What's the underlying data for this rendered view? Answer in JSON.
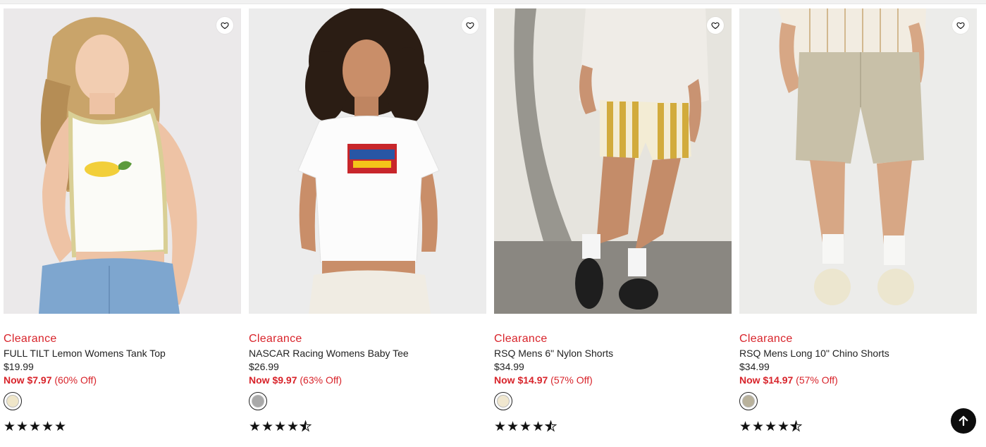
{
  "products": [
    {
      "badge": "Clearance",
      "name": "FULL TILT Lemon Womens Tank Top",
      "price": "$19.99",
      "sale_price": "Now $7.97",
      "discount": "(60% Off)",
      "swatch_color": "#efe6c9",
      "rating": 5,
      "image": "woman-lemon-tank-top"
    },
    {
      "badge": "Clearance",
      "name": "NASCAR Racing Womens Baby Tee",
      "price": "$26.99",
      "sale_price": "Now $9.97",
      "discount": "(63% Off)",
      "swatch_color": "#a9a9a9",
      "rating": 4.5,
      "image": "woman-nascar-baby-tee"
    },
    {
      "badge": "Clearance",
      "name": "RSQ Mens 6\" Nylon Shorts",
      "price": "$34.99",
      "sale_price": "Now $14.97",
      "discount": "(57% Off)",
      "swatch_color": "#f0e7cf",
      "rating": 4.5,
      "image": "man-striped-nylon-shorts"
    },
    {
      "badge": "Clearance",
      "name": "RSQ Mens Long 10\" Chino Shorts",
      "price": "$34.99",
      "sale_price": "Now $14.97",
      "discount": "(57% Off)",
      "swatch_color": "#b9b29c",
      "rating": 4.5,
      "image": "man-khaki-chino-shorts"
    }
  ],
  "icons": {
    "favorite": "heart-icon",
    "back_to_top": "arrow-up-icon",
    "rating": "star-icon"
  },
  "colors": {
    "sale_red": "#d8232a",
    "text": "#222222",
    "button_dark": "#0d0d0d"
  }
}
